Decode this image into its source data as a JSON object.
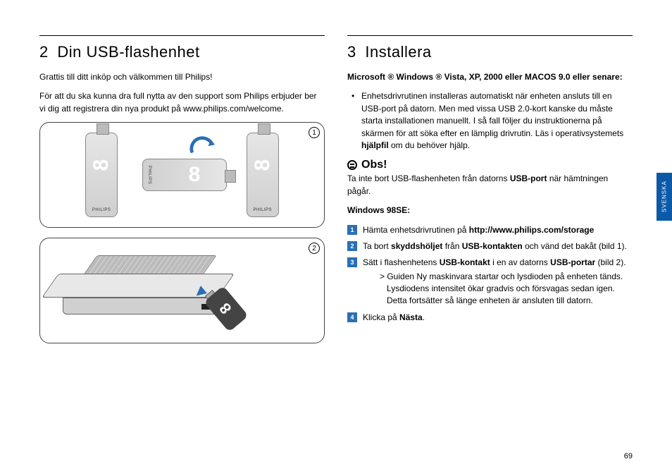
{
  "left": {
    "heading_num": "2",
    "heading": "Din USB-flashenhet",
    "intro1": "Grattis till ditt inköp och välkommen till Philips!",
    "intro2": "För att du ska kunna dra full nytta av den support som Philips erbjuder ber vi dig att registrera din nya produkt på www.philips.com/welcome.",
    "fig1_label": "1",
    "fig2_label": "2",
    "usb_brand": "PHILIPS"
  },
  "right": {
    "heading_num": "3",
    "heading": "Installera",
    "os_heading": "Microsoft ® Windows ® Vista, XP, 2000 eller MACOS 9.0 eller senare:",
    "bullet1_a": "Enhetsdrivrutinen installeras automatiskt när enheten ansluts till en USB-port på datorn. Men med vissa USB 2.0-kort kanske du måste starta installationen manuellt. I så fall följer du instruktionerna på skärmen för att söka efter en lämplig drivrutin. Läs i operativsystemets ",
    "bullet1_b_bold": "hjälpfil",
    "bullet1_c": " om du behöver hjälp.",
    "obs_label": "Obs!",
    "obs_text_a": "Ta inte bort USB-flashenheten från datorns ",
    "obs_text_b_bold": "USB-port",
    "obs_text_c": " när hämtningen pågår.",
    "win98_heading": "Windows 98SE:",
    "steps": [
      {
        "n": "1",
        "a": "Hämta enhetsdrivrutinen på ",
        "b_bold": "http://www.philips.com/storage"
      },
      {
        "n": "2",
        "a": "Ta bort ",
        "b_bold": "skyddshöljet",
        "c": " från ",
        "d_bold": "USB-kontakten",
        "e": " och vänd det bakåt (bild 1)."
      },
      {
        "n": "3",
        "a": "Sätt i flashenhetens ",
        "b_bold": "USB-kontakt",
        "c": " i en av datorns ",
        "d_bold": "USB-portar",
        "e": " (bild 2)."
      },
      {
        "n": "4",
        "a": "Klicka på ",
        "b_bold": "Nästa",
        "c": "."
      }
    ],
    "sub_text": "Guiden Ny maskinvara startar och lysdioden på enheten tänds. Lysdiodens intensitet ökar gradvis och försvagas sedan igen. Detta fortsätter så länge enheten är ansluten till datorn."
  },
  "lang_tab": "SVENSKA",
  "page_number": "69"
}
